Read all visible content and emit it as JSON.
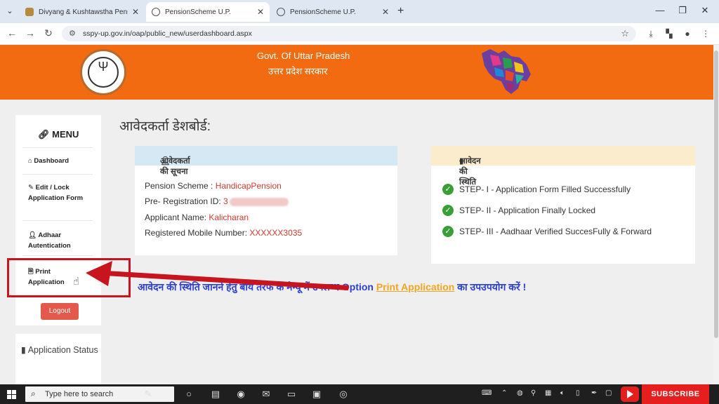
{
  "browser": {
    "tabs": [
      {
        "label": "Divyang & Kushtawstha Pensio",
        "active": false
      },
      {
        "label": "PensionScheme U.P.",
        "active": true
      },
      {
        "label": "PensionScheme U.P.",
        "active": false
      }
    ],
    "url": "sspy-up.gov.in/oap/public_new/userdashboard.aspx"
  },
  "header": {
    "title_en": "Govt. Of Uttar Pradesh",
    "title_hi": "उत्तर प्रदेश सरकार"
  },
  "menu": {
    "title": "MENU",
    "items": [
      {
        "label": "Dashboard"
      },
      {
        "label": "Edit / Lock Application Form"
      },
      {
        "label": "Adhaar Autentication"
      },
      {
        "label": "Print Application"
      }
    ],
    "logout_label": "Logout",
    "status_label": "Application Status"
  },
  "page": {
    "heading": "आवेदकर्ता डेशबोर्ड:"
  },
  "applicant_info": {
    "title": "आवेदकर्ता की सूचना",
    "scheme_label": "Pension Scheme :",
    "scheme_value": "HandicapPension",
    "reg_label": "Pre- Registration ID:",
    "reg_value": "3",
    "name_label": "Applicant Name:",
    "name_value": "Kalicharan",
    "mobile_label": "Registered Mobile Number:",
    "mobile_value": "XXXXXX3035"
  },
  "application_status": {
    "title": "आवेदन की स्थिति",
    "steps": [
      {
        "text": "STEP- I - Application Form Filled Successfully"
      },
      {
        "text": "STEP- II - Application Finally Locked"
      },
      {
        "text": "STEP- III - Aadhaar Verified SuccesFully & Forward"
      }
    ]
  },
  "notice": {
    "prefix": "आवेदन की स्थिति जानने हेतु बायें तरफ के मेन्यू में उपलब्ध Option",
    "link": "Print Application",
    "suffix": "का उपउपयोग करें !"
  },
  "taskbar": {
    "search_placeholder": "Type here to search",
    "subscribe_label": "SUBSCRIBE"
  },
  "colors": {
    "header_orange": "#f26b11",
    "notice_blue": "#2d3fd1",
    "link_orange": "#f2a51e",
    "value_red": "#d33a2c",
    "highlight_red": "#c8141e",
    "check_green": "#3a9e38"
  }
}
